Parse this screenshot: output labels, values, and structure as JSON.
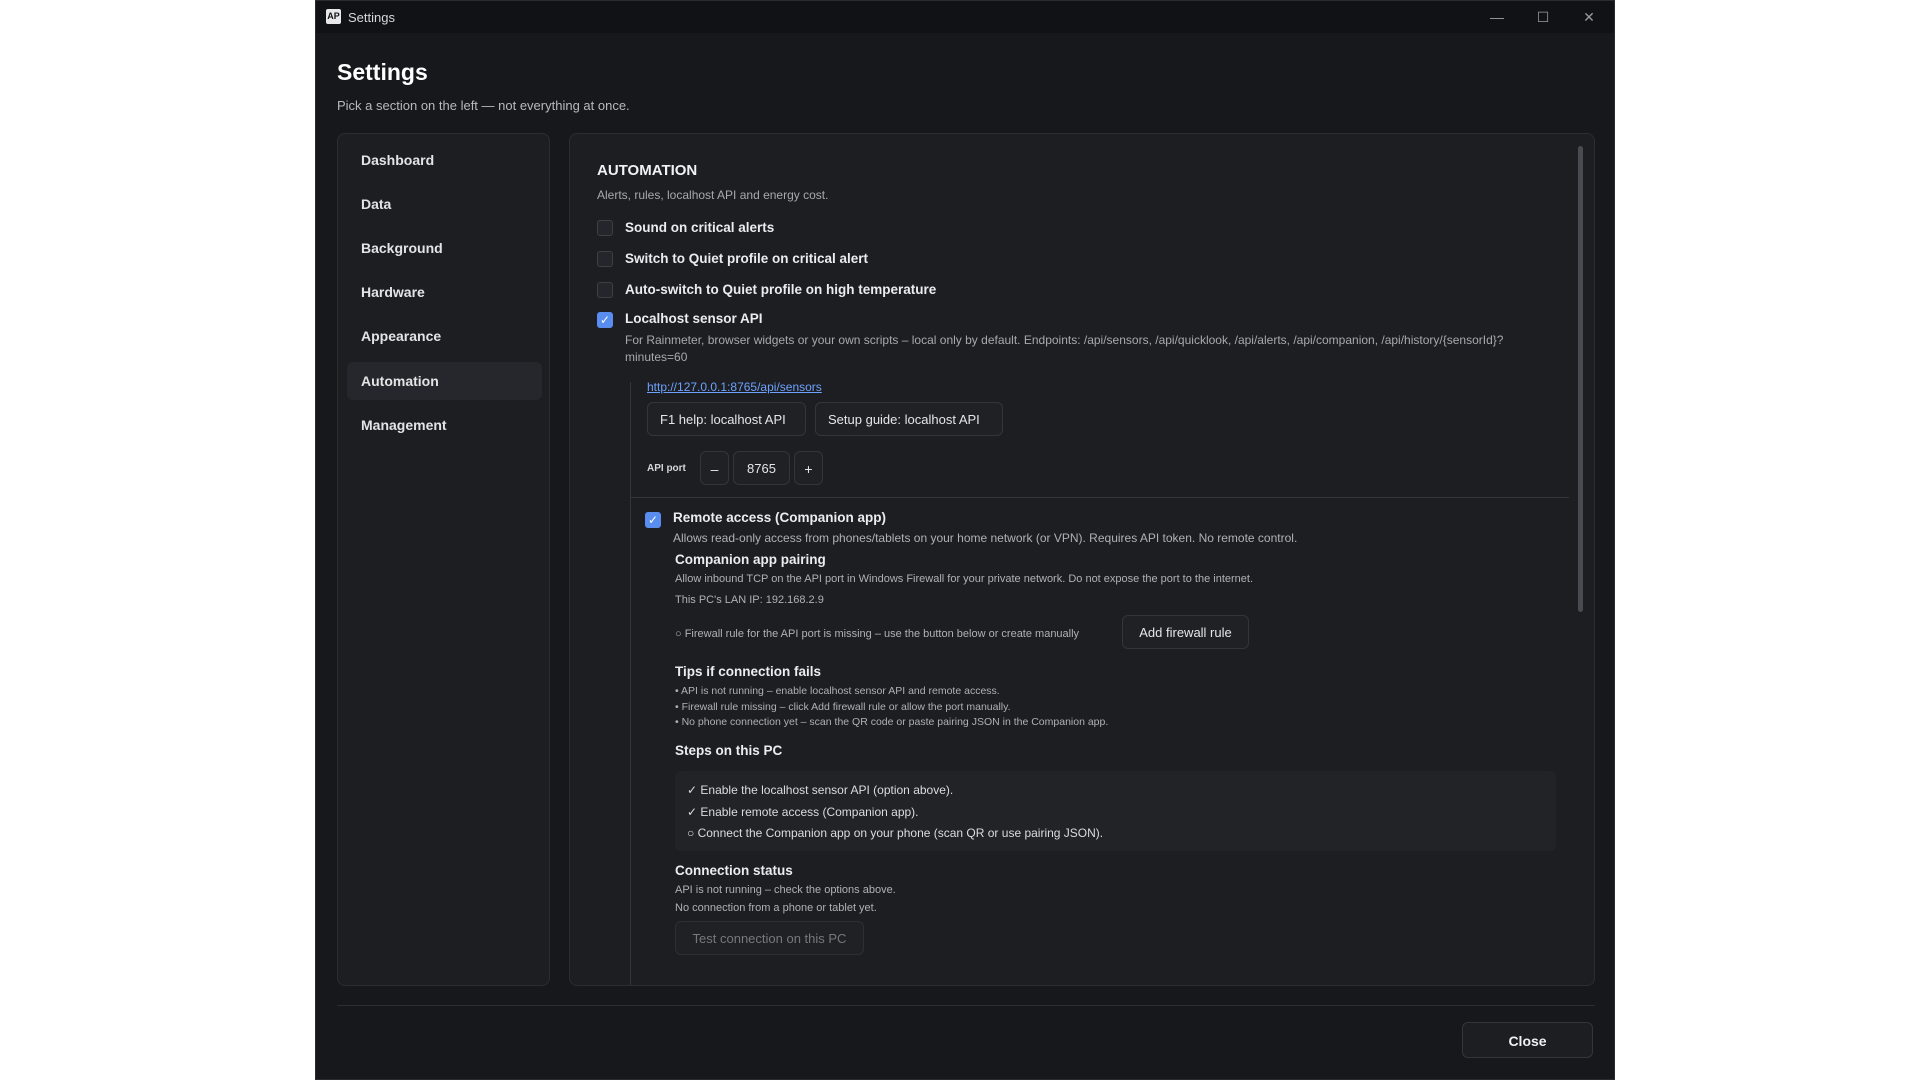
{
  "window": {
    "title": "Settings",
    "icon_text": "AP",
    "controls": {
      "minimize": "—",
      "maximize": "☐",
      "close": "✕"
    }
  },
  "page": {
    "title": "Settings",
    "subtitle": "Pick a section on the left — not everything at once."
  },
  "nav": {
    "items": [
      {
        "label": "Dashboard",
        "active": false
      },
      {
        "label": "Data",
        "active": false
      },
      {
        "label": "Background",
        "active": false
      },
      {
        "label": "Hardware",
        "active": false
      },
      {
        "label": "Appearance",
        "active": false
      },
      {
        "label": "Automation",
        "active": true
      },
      {
        "label": "Management",
        "active": false
      }
    ]
  },
  "automation": {
    "title": "AUTOMATION",
    "subtitle": "Alerts, rules, localhost API and energy cost.",
    "options": [
      {
        "label": "Sound on critical alerts",
        "checked": false
      },
      {
        "label": "Switch to Quiet profile on critical alert",
        "checked": false
      },
      {
        "label": "Auto-switch to Quiet profile on high temperature",
        "checked": false
      },
      {
        "label": "Localhost sensor API",
        "checked": true
      }
    ],
    "api_description": "For Rainmeter, browser widgets or your own scripts – local only by default. Endpoints: /api/sensors, /api/quicklook, /api/alerts, /api/companion, /api/history/{sensorId}?minutes=60",
    "api_link": "http://127.0.0.1:8765/api/sensors",
    "help_button": "F1 help: localhost API",
    "guide_button": "Setup guide: localhost API",
    "port": {
      "label": "API port",
      "value": "8765",
      "decrement": "–",
      "increment": "+"
    },
    "remote": {
      "label": "Remote access (Companion app)",
      "checked": true,
      "description": "Allows read-only access from phones/tablets on your home network (or VPN). Requires API token. No remote control."
    },
    "pairing": {
      "title": "Companion app pairing",
      "text": "Allow inbound TCP on the API port in Windows Firewall for your private network. Do not expose the port to the internet.",
      "lan_ip": "This PC's LAN IP: 192.168.2.9",
      "firewall_status": "○ Firewall rule for the API port is missing – use the button below or create manually",
      "firewall_button": "Add firewall rule"
    },
    "tips": {
      "title": "Tips if connection fails",
      "items": [
        "• API is not running – enable localhost sensor API and remote access.",
        "• Firewall rule missing – click Add firewall rule or allow the port manually.",
        "• No phone connection yet – scan the QR code or paste pairing JSON in the Companion app."
      ]
    },
    "steps": {
      "title": "Steps on this PC",
      "items": [
        "✓ Enable the localhost sensor API (option above).",
        "✓ Enable remote access (Companion app).",
        "○ Connect the Companion app on your phone (scan QR or use pairing JSON)."
      ]
    },
    "connection": {
      "title": "Connection status",
      "lines": [
        "API is not running – check the options above.",
        "No connection from a phone or tablet yet."
      ],
      "test_button": "Test connection on this PC"
    }
  },
  "footer": {
    "close_button": "Close"
  },
  "colors": {
    "accent": "#5a8df0",
    "link": "#6ea2ff",
    "background": "#17181b",
    "panel": "#1d1e22"
  }
}
